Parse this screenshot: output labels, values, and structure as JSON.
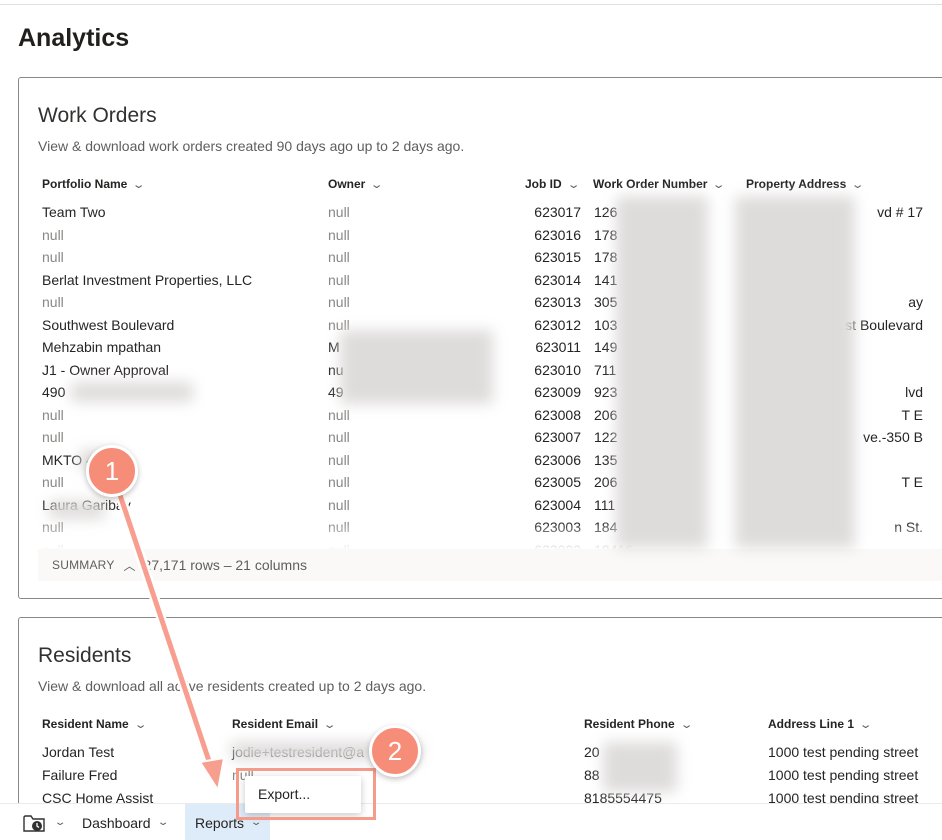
{
  "page": {
    "title": "Analytics"
  },
  "work_orders": {
    "title": "Work Orders",
    "description": "View & download work orders created 90 days ago up to 2 days ago.",
    "columns": [
      "Portfolio Name",
      "Owner",
      "Job ID",
      "Work Order Number",
      "Property Address"
    ],
    "rows": [
      {
        "portfolio": "Team Two",
        "owner": "null",
        "job_id": "623017",
        "wo_number": "126",
        "address": "vd # 17"
      },
      {
        "portfolio": "null",
        "owner": "null",
        "job_id": "623016",
        "wo_number": "178",
        "address": ""
      },
      {
        "portfolio": "null",
        "owner": "null",
        "job_id": "623015",
        "wo_number": "178",
        "address": ""
      },
      {
        "portfolio": "Berlat Investment Properties, LLC",
        "owner": "null",
        "job_id": "623014",
        "wo_number": "141",
        "address": ""
      },
      {
        "portfolio": "null",
        "owner": "null",
        "job_id": "623013",
        "wo_number": "305",
        "address": "ay"
      },
      {
        "portfolio": "Southwest Boulevard",
        "owner": "null",
        "job_id": "623012",
        "wo_number": "103",
        "address": "st Boulevard"
      },
      {
        "portfolio": "Mehzabin mpathan",
        "owner": "M",
        "job_id": "623011",
        "wo_number": "149",
        "address": ""
      },
      {
        "portfolio": "J1 - Owner Approval",
        "owner": "nu",
        "job_id": "623010",
        "wo_number": "711",
        "address": ""
      },
      {
        "portfolio": "490",
        "owner": "49",
        "job_id": "623009",
        "wo_number": "923",
        "address": "lvd"
      },
      {
        "portfolio": "null",
        "owner": "null",
        "job_id": "623008",
        "wo_number": "206",
        "address": "T E"
      },
      {
        "portfolio": "null",
        "owner": "null",
        "job_id": "623007",
        "wo_number": "122",
        "address": "ve.-350 B"
      },
      {
        "portfolio": "MKTO 4",
        "owner": "null",
        "job_id": "623006",
        "wo_number": "135",
        "address": ""
      },
      {
        "portfolio": "null",
        "owner": "null",
        "job_id": "623005",
        "wo_number": "206",
        "address": "T E"
      },
      {
        "portfolio": "Laura Garibay",
        "owner": "null",
        "job_id": "623004",
        "wo_number": "111",
        "address": ""
      },
      {
        "portfolio": "null",
        "owner": "null",
        "job_id": "623003",
        "wo_number": "184",
        "address": "n St."
      },
      {
        "portfolio": "null",
        "owner": "null",
        "job_id": "623002",
        "wo_number": "18416",
        "address": ""
      }
    ],
    "summary_label": "SUMMARY",
    "summary_count": "27,171 rows – 21 columns"
  },
  "residents": {
    "title": "Residents",
    "description": "View & download all active residents created up to 2 days ago.",
    "columns": [
      "Resident Name",
      "Resident Email",
      "Resident Phone",
      "Address Line 1"
    ],
    "rows": [
      {
        "name": "Jordan Test",
        "email": "jodie+testresident@a",
        "phone": "20",
        "address": "1000 test pending street"
      },
      {
        "name": "Failure Fred",
        "email": "null",
        "phone": "88",
        "address": "1000 test pending street"
      },
      {
        "name": "CSC Home Assist",
        "email": "",
        "phone": "8185554475",
        "address": "1000 test pending street"
      }
    ]
  },
  "taskbar": {
    "dashboard_label": "Dashboard",
    "reports_label": "Reports"
  },
  "context_menu": {
    "export_label": "Export..."
  },
  "annotations": {
    "step1": "1",
    "step2": "2"
  },
  "colors": {
    "annotation": "#f58d79",
    "active_tab": "#deecf9"
  }
}
